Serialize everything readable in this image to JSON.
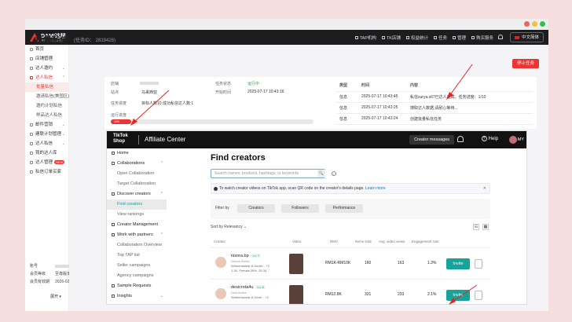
{
  "window": {
    "dots": [
      "#f0625c",
      "#f7be3c",
      "#30c548"
    ]
  },
  "topnav": {
    "brand": "DAMI达秘",
    "brand_sub": "跨境达人营销服务",
    "items": [
      "TAP机构",
      "TK店铺",
      "权益统计",
      "任务",
      "管理",
      "购买服务"
    ],
    "lang": "中文简体"
  },
  "sidebar": {
    "items": [
      {
        "label": "首页",
        "type": "top"
      },
      {
        "label": "店铺管理",
        "type": "top"
      },
      {
        "label": "达人邀约",
        "type": "top",
        "caret": "⌄"
      },
      {
        "label": "达人私信",
        "type": "open",
        "caret": "⌃"
      },
      {
        "label": "批量私信",
        "type": "active"
      },
      {
        "label": "邀请私信(美国区)",
        "type": "sub"
      },
      {
        "label": "邀约计划私信",
        "type": "sub"
      },
      {
        "label": "样品达人私信",
        "type": "sub"
      },
      {
        "label": "邮件营销",
        "type": "top",
        "caret": "⌄"
      },
      {
        "label": "建联计划管理",
        "type": "top",
        "caret": "⌄"
      },
      {
        "label": "达人私信",
        "type": "top",
        "caret": "⌄"
      },
      {
        "label": "我的达人库",
        "type": "top"
      },
      {
        "label": "达人管理",
        "type": "top",
        "badge": "NEW",
        "caret": "⌄"
      },
      {
        "label": "私信订单买家",
        "type": "top"
      }
    ],
    "account": {
      "rows": [
        {
          "label": "账号",
          "value": ""
        },
        {
          "label": "会员等级",
          "value": "至尊版年度套餐"
        },
        {
          "label": "会员有效期",
          "value": "2026-02-26"
        }
      ],
      "collapse": "展开 ▾"
    }
  },
  "page": {
    "title": "批量私信",
    "task_id": "(任务ID： 2819428)",
    "stop_button": "停止任务",
    "fields": {
      "shop_label": "店铺",
      "site_label": "站点",
      "site_value": "马来西亚",
      "progress_label": "任务进度",
      "progress_value": "目标人数10    成功私信达人数:1",
      "status_label": "任务状态",
      "status_value": "运行中",
      "start_label": "开始时间",
      "start_value": "2025-07-17 10:43:16",
      "run_label": "运行进度",
      "run_percent": "10%"
    },
    "progress_fraction": 0.1,
    "log": {
      "headers": [
        "类型",
        "时间",
        "内容"
      ],
      "rows": [
        [
          "信息",
          "2025-07-17 10:43:45",
          "私信surya.s67已达人完成。任务进度：1/10"
        ],
        [
          "信息",
          "2025-07-17 10:43:25",
          "搜取达人数据,请耐心等待..."
        ],
        [
          "信息",
          "2025-07-17 10:43:24",
          "创建批量私信任务"
        ]
      ]
    }
  },
  "tiktok": {
    "logo_line1": "TikTok",
    "logo_line2": "Shop",
    "title": "Affiliate Center",
    "creator_messages": "Creator messages",
    "help": "Help",
    "help_q": "?",
    "user": "MY",
    "nav": [
      {
        "label": "Home",
        "type": "top"
      },
      {
        "label": "Collaborations",
        "type": "top",
        "caret": "⌃"
      },
      {
        "label": "Open Collaboration",
        "type": "sub"
      },
      {
        "label": "Target Collaboration",
        "type": "sub"
      },
      {
        "label": "Discover creators",
        "type": "top",
        "caret": "⌃"
      },
      {
        "label": "Find creators",
        "type": "sel"
      },
      {
        "label": "View rankings",
        "type": "sub"
      },
      {
        "label": "Creator Management",
        "type": "top"
      },
      {
        "label": "Work with partners",
        "type": "top",
        "caret": "⌃"
      },
      {
        "label": "Collaboration Overview",
        "type": "sub"
      },
      {
        "label": "Top TAP list",
        "type": "sub"
      },
      {
        "label": "Seller campaigns",
        "type": "sub"
      },
      {
        "label": "Agency campaigns",
        "type": "sub"
      },
      {
        "label": "Sample Requests",
        "type": "top"
      },
      {
        "label": "Insights",
        "type": "top",
        "caret": "⌄"
      }
    ],
    "find": {
      "title": "Find creators",
      "search_placeholder": "Search names, products, hashtags, or keywords",
      "search_glyph": "🔍",
      "info_glyph": "i",
      "banner_text": "To watch creator videos on TikTok app, scan QR code on the creator's details page.",
      "banner_link": "Learn more",
      "banner_close": "✕",
      "filter_by": "Filter by",
      "filters": [
        "Creators",
        "Followers",
        "Performance"
      ],
      "sort": "Sort by Relevancy ⌄",
      "view_icons": [
        "☷",
        "▦"
      ],
      "columns": [
        "Creator",
        "Video",
        "RMV",
        "Items sold",
        "Avg. video views",
        "Engagement rate"
      ],
      "rows": [
        {
          "name": "nisora.bp",
          "level": "Lv. 7",
          "sub": "Nisora Sarira",
          "cat": "Womenswear & Under... +2",
          "stats": "1.2K, Female 26%, 25-34",
          "rmv": "RM1K-RM10K",
          "sold": "160",
          "views": "163",
          "eng": "1.3%",
          "invite": "Invite"
        },
        {
          "name": "desicrota4u",
          "level": "Lv. 6",
          "sub": "Desi Ardita",
          "cat": "Womenswear & Unde... +2",
          "stats": "",
          "rmv": "RM12.8K",
          "sold": "331",
          "views": "233",
          "eng": "2.1%",
          "invite": "Invite"
        }
      ]
    }
  }
}
